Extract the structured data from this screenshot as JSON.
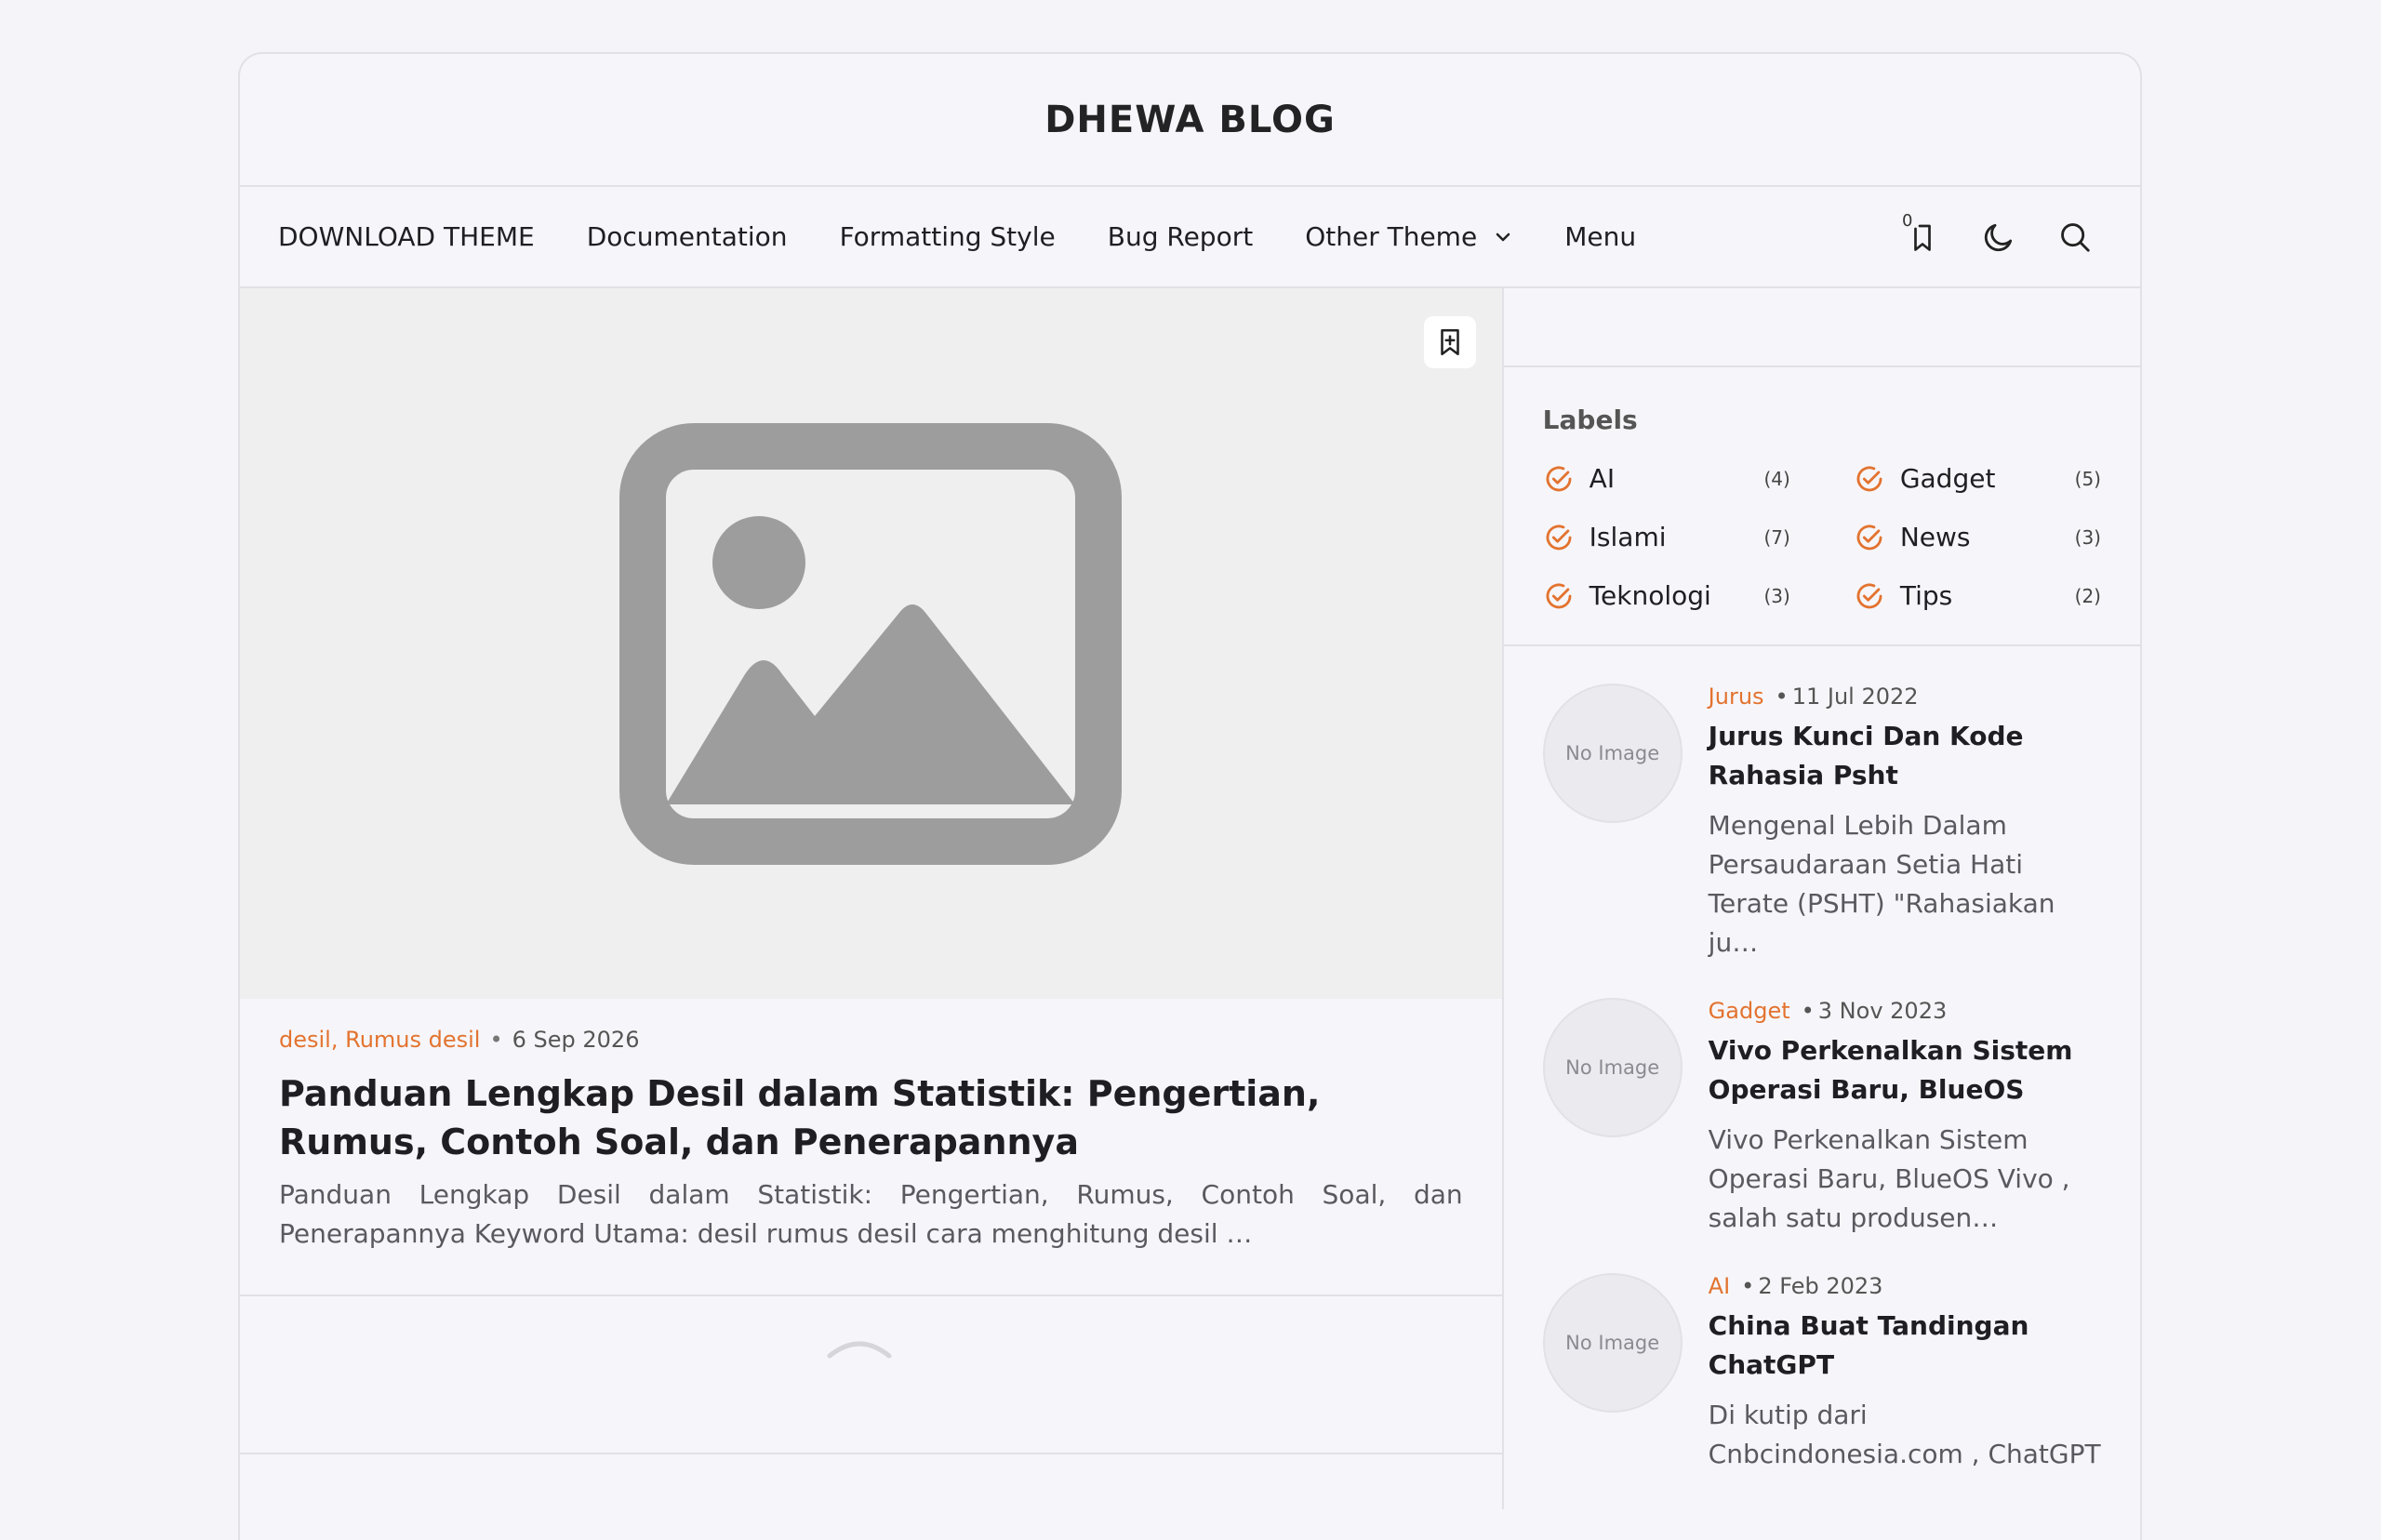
{
  "site": {
    "title": "DHEWA BLOG"
  },
  "nav": {
    "items": [
      "DOWNLOAD THEME",
      "Documentation",
      "Formatting Style",
      "Bug Report",
      "Other Theme",
      "Menu"
    ],
    "bookmark_count": "0"
  },
  "featured": {
    "labels": "desil, Rumus desil",
    "date": "6 Sep 2026",
    "title": "Panduan Lengkap Desil dalam Statistik: Pengertian, Rumus, Contoh Soal, dan Penerapannya",
    "snippet": "Panduan Lengkap Desil dalam Statistik: Pengertian, Rumus, Contoh Soal, dan Penerapannya Keyword Utama: desil rumus desil cara menghitung desil …"
  },
  "labels_widget": {
    "title": "Labels",
    "items": [
      {
        "name": "AI",
        "count": "(4)"
      },
      {
        "name": "Gadget",
        "count": "(5)"
      },
      {
        "name": "Islami",
        "count": "(7)"
      },
      {
        "name": "News",
        "count": "(3)"
      },
      {
        "name": "Teknologi",
        "count": "(3)"
      },
      {
        "name": "Tips",
        "count": "(2)"
      }
    ]
  },
  "recent_posts": [
    {
      "thumb": "No Image",
      "label": "Jurus",
      "date": "11 Jul 2022",
      "title": "Jurus Kunci Dan Kode Rahasia Psht",
      "snippet": "Mengenal Lebih Dalam Persaudaraan Setia Hati Terate (PSHT) \"Rahasiakan ju…"
    },
    {
      "thumb": "No Image",
      "label": "Gadget",
      "date": "3 Nov 2023",
      "title": "Vivo Perkenalkan Sistem Operasi Baru, BlueOS",
      "snippet": "Vivo Perkenalkan Sistem Operasi Baru, BlueOS Vivo , salah satu produsen…"
    },
    {
      "thumb": "No Image",
      "label": "AI",
      "date": "2 Feb 2023",
      "title": "China Buat Tandingan ChatGPT",
      "snippet": "Di kutip dari Cnbcindonesia.com , ChatGPT"
    }
  ],
  "colors": {
    "accent": "#e3732f",
    "border": "#e1e1e6",
    "background": "#f5f5f9"
  }
}
